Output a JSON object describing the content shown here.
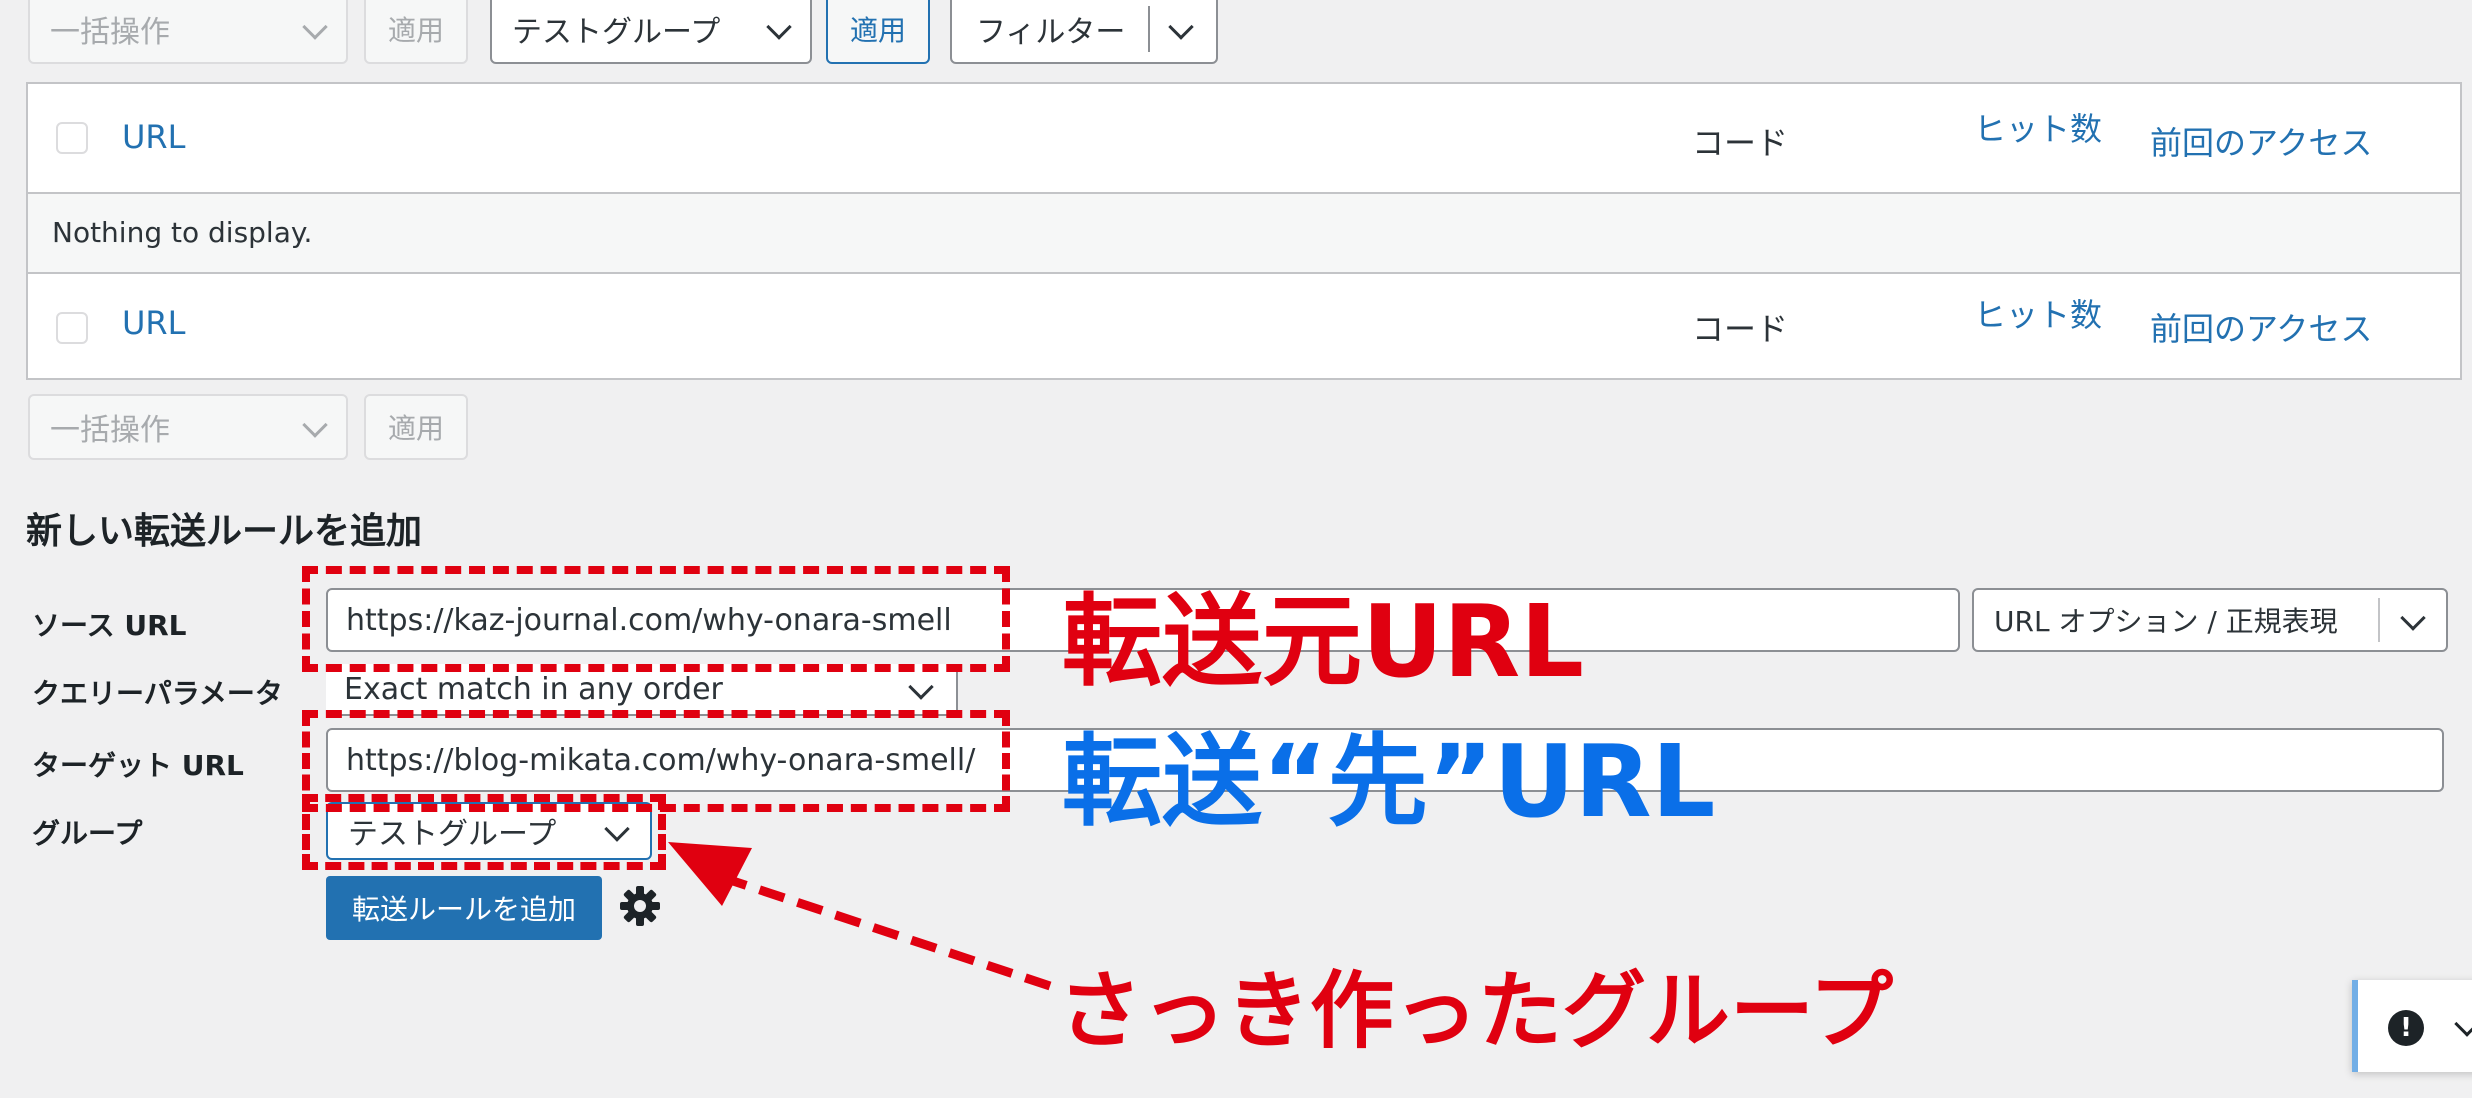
{
  "top_controls": {
    "bulk_action": "一括操作",
    "apply": "適用",
    "group_select": "テストグループ",
    "apply_active": "適用",
    "filter": "フィルター"
  },
  "table": {
    "header": {
      "url": "URL",
      "code": "コード",
      "hits": "ヒット数",
      "last_access": "前回のアクセス"
    },
    "empty_message": "Nothing to display.",
    "footer": {
      "url": "URL",
      "code": "コード",
      "hits": "ヒット数",
      "last_access": "前回のアクセス"
    }
  },
  "bottom_controls": {
    "bulk_action": "一括操作",
    "apply": "適用"
  },
  "form": {
    "title": "新しい転送ルールを追加",
    "source_label": "ソース URL",
    "source_value": "https://kaz-journal.com/why-onara-smell",
    "url_options": "URL オプション / 正規表現",
    "query_label": "クエリーパラメータ",
    "query_value": "Exact match in any order",
    "target_label": "ターゲット URL",
    "target_value": "https://blog-mikata.com/why-onara-smell/",
    "group_label": "グループ",
    "group_value": "テストグループ",
    "submit": "転送ルールを追加"
  },
  "annotations": {
    "source_note": "転送元URL",
    "target_note": "転送“先”URL",
    "group_note": "さっき作ったグループ",
    "red": "#e00010",
    "blue": "#0a6fe8"
  },
  "colors": {
    "accent": "#2271b1",
    "background": "#f0f0f1"
  },
  "icons": {
    "settings": "gear-icon",
    "notice": "exclamation-icon"
  }
}
